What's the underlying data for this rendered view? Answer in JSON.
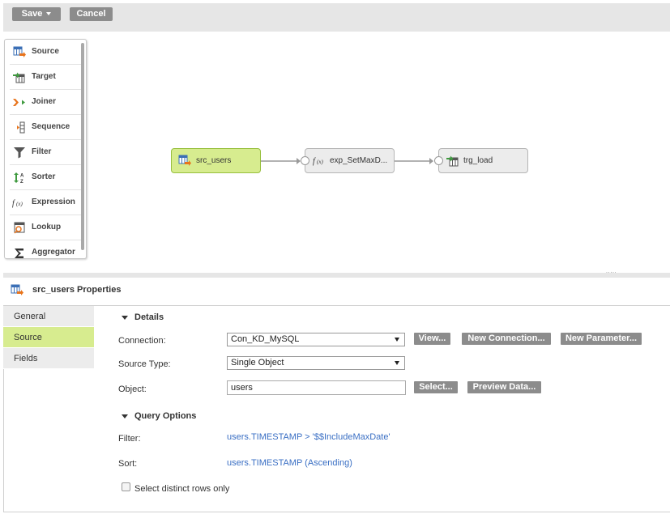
{
  "toolbar": {
    "save_label": "Save",
    "cancel_label": "Cancel"
  },
  "palette": {
    "items": [
      {
        "label": "Source",
        "icon": "source-icon"
      },
      {
        "label": "Target",
        "icon": "target-icon"
      },
      {
        "label": "Joiner",
        "icon": "joiner-icon"
      },
      {
        "label": "Sequence",
        "icon": "sequence-icon"
      },
      {
        "label": "Filter",
        "icon": "filter-icon"
      },
      {
        "label": "Sorter",
        "icon": "sorter-icon"
      },
      {
        "label": "Expression",
        "icon": "expression-icon"
      },
      {
        "label": "Lookup",
        "icon": "lookup-icon"
      },
      {
        "label": "Aggregator",
        "icon": "aggregator-icon"
      }
    ]
  },
  "mapping": {
    "nodes": [
      {
        "label": "src_users",
        "icon": "source-icon",
        "selected": true
      },
      {
        "label": "exp_SetMaxD...",
        "icon": "expression-icon",
        "selected": false
      },
      {
        "label": "trg_load",
        "icon": "target-icon",
        "selected": false
      }
    ]
  },
  "properties": {
    "title": "src_users Properties",
    "tabs": [
      {
        "label": "General",
        "active": false
      },
      {
        "label": "Source",
        "active": true
      },
      {
        "label": "Fields",
        "active": false
      }
    ],
    "details": {
      "heading": "Details",
      "connection_label": "Connection:",
      "connection_value": "Con_KD_MySQL",
      "view_button": "View...",
      "new_connection_button": "New Connection...",
      "new_parameter_button": "New Parameter...",
      "source_type_label": "Source Type:",
      "source_type_value": "Single Object",
      "object_label": "Object:",
      "object_value": "users",
      "select_button": "Select...",
      "preview_button": "Preview Data..."
    },
    "query_options": {
      "heading": "Query Options",
      "filter_label": "Filter:",
      "filter_value": "users.TIMESTAMP > '$$IncludeMaxDate'",
      "sort_label": "Sort:",
      "sort_value": "users.TIMESTAMP (Ascending)",
      "distinct_label": "Select distinct rows only",
      "distinct_checked": false
    }
  },
  "colors": {
    "accent_green": "#d7ec8f",
    "button_gray": "#8c8c8c",
    "link_blue": "#3a6fc4"
  }
}
